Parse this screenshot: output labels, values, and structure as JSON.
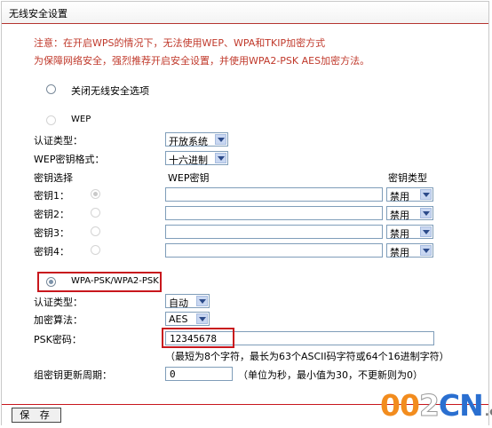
{
  "window": {
    "title": "无线安全设置"
  },
  "notes": {
    "line1": "注意：在开启WPS的情况下，无法使用WEP、WPA和TKIP加密方式",
    "line2": "为保障网络安全，强烈推荐开启安全设置，并使用WPA2-PSK AES加密方法。"
  },
  "disable_option": {
    "label": "关闭无线安全选项",
    "selected": false
  },
  "wep": {
    "option_label": "WEP",
    "selected": false,
    "auth_label": "认证类型：",
    "auth_value": "开放系统",
    "format_label": "WEP密钥格式：",
    "format_value": "十六进制",
    "col_key_select": "密钥选择",
    "col_wep_key": "WEP密钥",
    "col_key_type": "密钥类型",
    "keys": [
      {
        "label": "密钥1：",
        "value": "",
        "type": "禁用",
        "checked": true
      },
      {
        "label": "密钥2：",
        "value": "",
        "type": "禁用",
        "checked": false
      },
      {
        "label": "密钥3：",
        "value": "",
        "type": "禁用",
        "checked": false
      },
      {
        "label": "密钥4：",
        "value": "",
        "type": "禁用",
        "checked": false
      }
    ]
  },
  "wpa": {
    "option_label": "WPA-PSK/WPA2-PSK",
    "selected": true,
    "auth_label": "认证类型：",
    "auth_value": "自动",
    "algo_label": "加密算法：",
    "algo_value": "AES",
    "psk_label": "PSK密码：",
    "psk_value": "12345678",
    "psk_hint": "（最短为8个字符，最长为63个ASCII码字符或64个16进制字符）",
    "renew_label": "组密钥更新周期：",
    "renew_value": "0",
    "renew_hint": "（单位为秒，最小值为30，不更新则为0）"
  },
  "save_button": "保 存",
  "watermark": {
    "part1": "00",
    "part2": "2",
    "part3": "CN",
    "part4": ".cn"
  },
  "colors": {
    "warning": "#c0392b",
    "highlight_border": "#c8171d",
    "logo_orange": "#f28c1e",
    "logo_blue": "#2a6fd0"
  }
}
